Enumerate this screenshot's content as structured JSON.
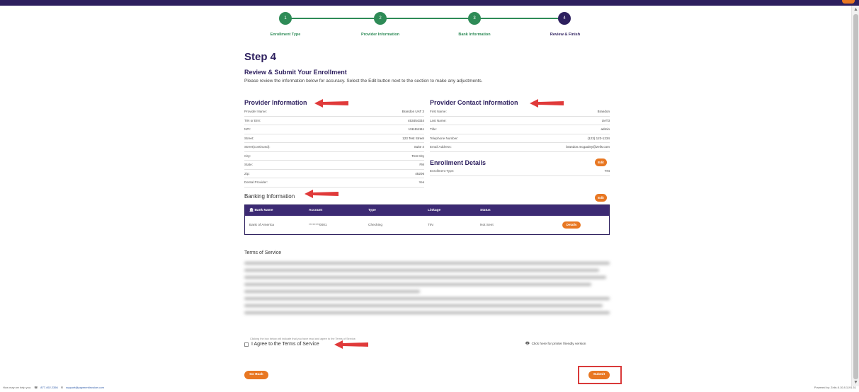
{
  "steps": [
    {
      "number": "1",
      "label": "Enrollment Type"
    },
    {
      "number": "2",
      "label": "Provider Information"
    },
    {
      "number": "3",
      "label": "Bank Information"
    },
    {
      "number": "4",
      "label": "Review & Finish"
    }
  ],
  "page": {
    "step_title": "Step 4",
    "review_title": "Review & Submit Your Enrollment",
    "intro": "Please review the information below for accuracy. Select the Edit button next to the section to make any adjustments."
  },
  "provider_info": {
    "title": "Provider Information",
    "rows": [
      {
        "label": "Provider Name:",
        "value": "Brandon UAT 3"
      },
      {
        "label": "TIN or EIN:",
        "value": "453454334"
      },
      {
        "label": "NPI:",
        "value": "1111111111"
      },
      {
        "label": "Street:",
        "value": "123 Test Street"
      },
      {
        "label": "Street(continued):",
        "value": "Suite 4"
      },
      {
        "label": "City:",
        "value": "Test City"
      },
      {
        "label": "State:",
        "value": "FM"
      },
      {
        "label": "Zip:",
        "value": "45206"
      },
      {
        "label": "Dental Provider:",
        "value": "Yes"
      }
    ]
  },
  "contact_info": {
    "title": "Provider Contact Information",
    "rows": [
      {
        "label": "First Name:",
        "value": "Brandon"
      },
      {
        "label": "Last Name:",
        "value": "UAT3"
      },
      {
        "label": "Title:",
        "value": "admin"
      },
      {
        "label": "Telephone Number:",
        "value": "(123) 123-1234"
      },
      {
        "label": "Email Address:",
        "value": "brandon.mcgauley@zelis.com"
      }
    ]
  },
  "enrollment_details": {
    "title": "Enrollment Details",
    "edit_label": "Edit",
    "rows": [
      {
        "label": "Enrollment Type:",
        "value": "TIN"
      }
    ]
  },
  "banking": {
    "title": "Banking Information",
    "edit_label": "Edit",
    "headers": [
      "Bank Name",
      "Account",
      "Type",
      "Linkage",
      "Status"
    ],
    "rows": [
      {
        "bank": "Bank of America",
        "account": "********0001",
        "type": "Checking",
        "linkage": "TIN",
        "status": "Not Sent",
        "action": "Details"
      }
    ]
  },
  "terms": {
    "title": "Terms of Service",
    "note": "Clicking the box below will indicate that you have read and agree to the Terms of Service.",
    "agree_label": "I Agree to the Terms of Service",
    "printer_label": "Click here for printer friendly version"
  },
  "actions": {
    "go_back": "Go Back",
    "submit": "Submit"
  },
  "footer": {
    "help": "How may we help you:",
    "phone": "877.492.2356",
    "email": "support@paymentinvoice.com",
    "powered": "Powered by: Zelis 8.10.8.1191.51"
  },
  "colors": {
    "brand_purple": "#2d1f5e",
    "step_green": "#2e8b57",
    "accent_orange": "#e87722",
    "annotation_red": "#d93a3a"
  }
}
